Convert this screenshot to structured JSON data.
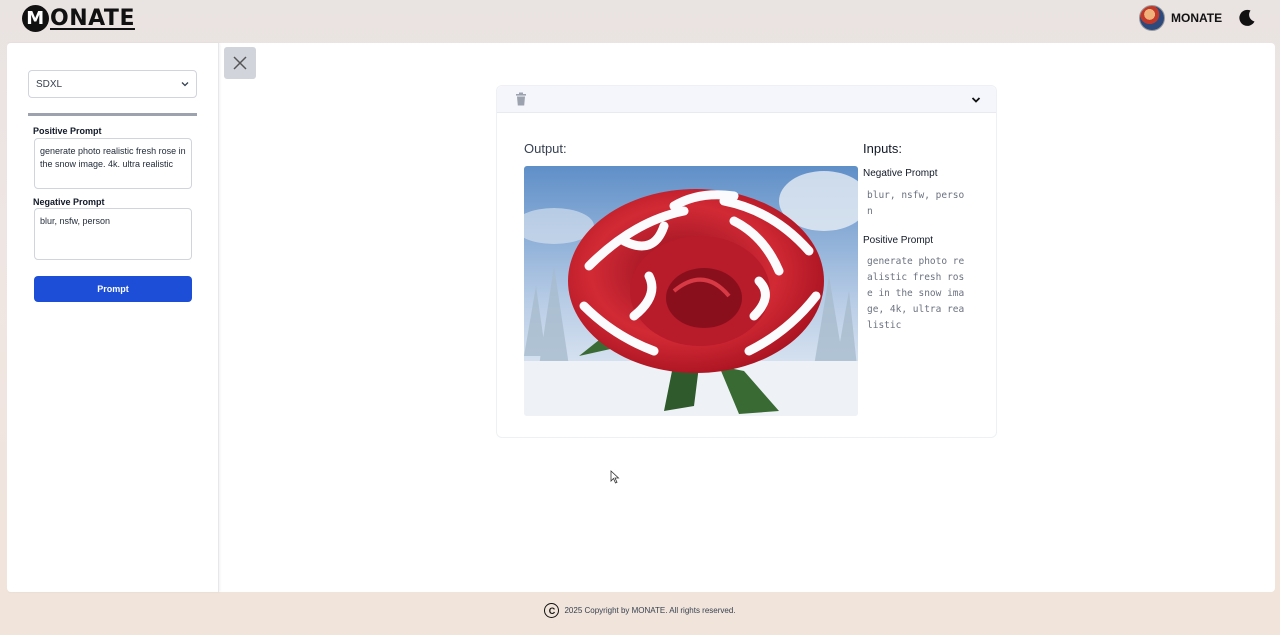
{
  "header": {
    "logo_letter": "M",
    "logo_text": "ONATE",
    "user_name": "MONATE"
  },
  "sidebar": {
    "model_select_value": "SDXL",
    "positive_label": "Positive Prompt",
    "positive_value": "generate photo realistic fresh rose in the snow image. 4k. ultra realistic",
    "negative_label": "Negative Prompt",
    "negative_value": "blur, nsfw, person",
    "prompt_button": "Prompt"
  },
  "result": {
    "output_label": "Output:",
    "inputs_label": "Inputs:",
    "negative_title": "Negative Prompt",
    "negative_value": "blur, nsfw, person",
    "positive_title": "Positive Prompt",
    "positive_value": "generate photo realistic fresh rose in the snow image, 4k, ultra realistic"
  },
  "footer": {
    "copyright_symbol": "C",
    "text": "2025 Copyright by MONATE. All rights reserved."
  },
  "icons": [
    "moon-icon",
    "close-icon",
    "trash-icon",
    "chevron-down-icon",
    "copyright-icon"
  ]
}
